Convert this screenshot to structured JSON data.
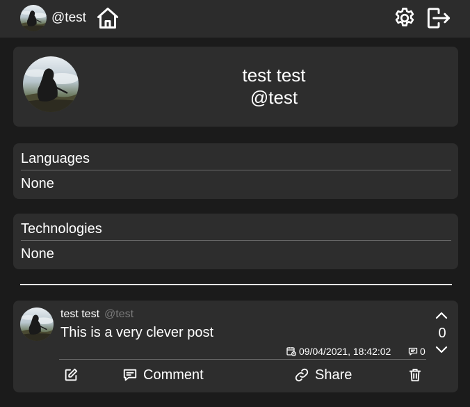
{
  "nav": {
    "username": "@test",
    "icons": {
      "avatar": "user-avatar",
      "home": "home-icon",
      "settings": "gear-icon",
      "logout": "logout-icon"
    }
  },
  "profile": {
    "name": "test test",
    "handle": "@test"
  },
  "sections": {
    "languages": {
      "title": "Languages",
      "value": "None"
    },
    "technologies": {
      "title": "Technologies",
      "value": "None"
    }
  },
  "post": {
    "author_name": "test test",
    "author_handle": "@test",
    "text": "This is a very clever post",
    "votes": "0",
    "date": "09/04/2021, 18:42:02",
    "comment_count": "0",
    "actions": {
      "edit_icon": "pencil-icon",
      "comment_label": "Comment",
      "share_label": "Share",
      "delete_icon": "trash-icon"
    }
  },
  "colors": {
    "background": "#1b1b1b",
    "topbar": "#2c2c2c",
    "card": "#2d2d2d",
    "text": "#ffffff",
    "muted": "#7a7a7a"
  }
}
